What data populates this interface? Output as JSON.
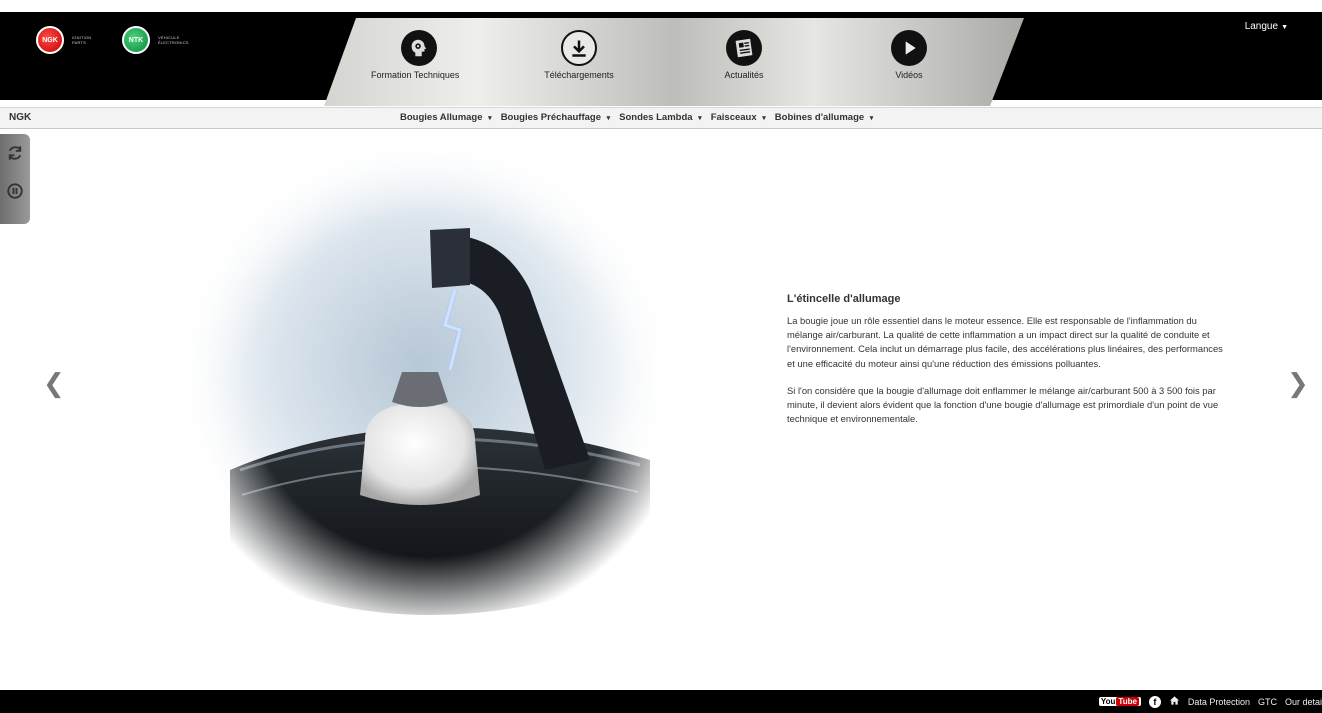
{
  "header": {
    "logos": [
      {
        "name": "NGK",
        "subtitle": "IGNITION PARTS"
      },
      {
        "name": "NTK",
        "subtitle": "VÉHICULE ÉLECTRONICS"
      }
    ],
    "langue_label": "Langue",
    "nav_items": [
      {
        "label": "Formation Techniques",
        "icon": "head-gear-icon"
      },
      {
        "label": "Téléchargements",
        "icon": "download-icon"
      },
      {
        "label": "Actualités",
        "icon": "newspaper-icon"
      },
      {
        "label": "Vidéos",
        "icon": "play-icon"
      }
    ]
  },
  "nav2": {
    "brand": "NGK",
    "menu": [
      "Bougies Allumage",
      "Bougies Préchauffage",
      "Sondes Lambda",
      "Faisceaux",
      "Bobines d'allumage"
    ]
  },
  "article": {
    "title": "L'étincelle d'allumage",
    "paragraphs": [
      "La bougie joue un rôle essentiel dans le moteur essence. Elle est responsable de l'inflammation du mélange air/carburant. La qualité de cette inflammation a un impact direct sur la qualité de conduite et l'environnement. Cela inclut un démarrage plus facile, des accélérations plus linéaires, des performances et une efficacité du moteur ainsi qu'une réduction des émissions polluantes.",
      "Si l'on considère que la bougie d'allumage doit enflammer le mélange air/carburant 500 à 3 500 fois par minute, il devient alors évident que la fonction d'une bougie d'allumage est primordiale d'un point de vue technique et environnementale."
    ]
  },
  "footer": {
    "youtube_a": "You",
    "youtube_b": "Tube",
    "facebook": "f",
    "links": [
      "Data Protection",
      "GTC",
      "Our detai"
    ]
  },
  "colors": {
    "header_bg": "#000000",
    "ngk_red": "#d40000",
    "ntk_green": "#0b8a3e"
  }
}
